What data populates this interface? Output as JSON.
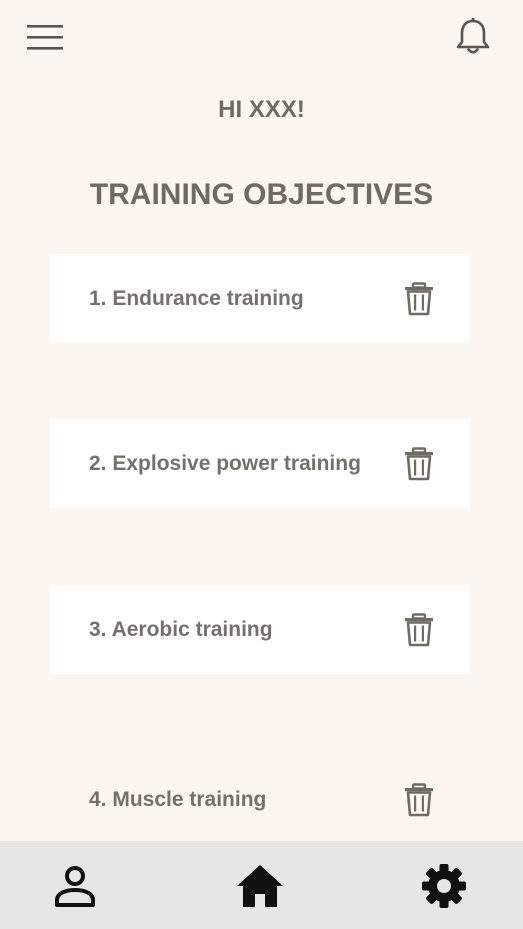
{
  "header": {
    "menu_icon": "hamburger-menu-icon",
    "notification_icon": "bell-icon"
  },
  "greeting": "HI XXX!",
  "page_title": "TRAINING OBJECTIVES",
  "objectives": [
    {
      "label": "1. Endurance training",
      "delete_icon": "trash-icon"
    },
    {
      "label": "2. Explosive power training",
      "delete_icon": "trash-icon"
    },
    {
      "label": "3. Aerobic training",
      "delete_icon": "trash-icon"
    },
    {
      "label": "4. Muscle training",
      "delete_icon": "trash-icon"
    }
  ],
  "bottom_nav": {
    "profile_icon": "person-icon",
    "home_icon": "home-icon",
    "settings_icon": "gear-icon"
  },
  "colors": {
    "background": "#fdf5ef",
    "card": "#ffffff",
    "text": "#6f6a64",
    "nav_bar": "#e6e6e6",
    "nav_icon": "#111111"
  }
}
